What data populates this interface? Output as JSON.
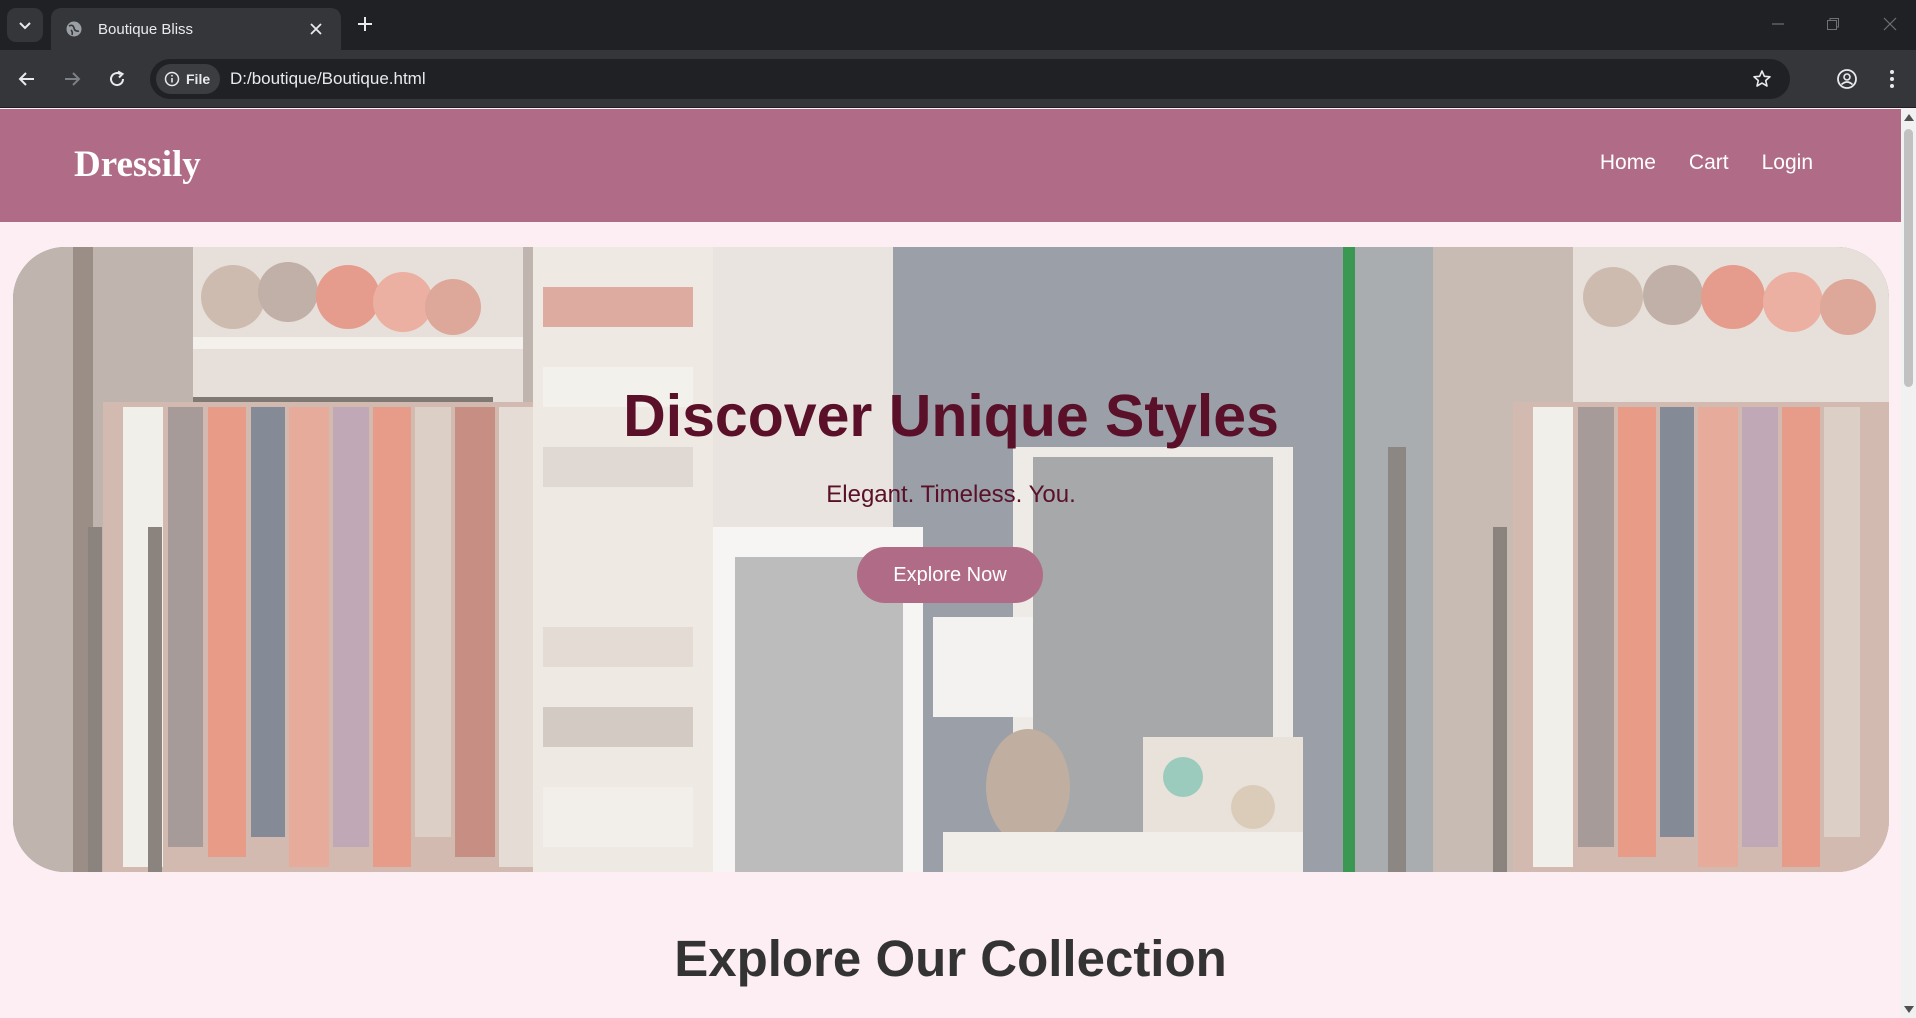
{
  "browser": {
    "tab_title": "Boutique Bliss",
    "url_chip": "File",
    "url": "D:/boutique/Boutique.html"
  },
  "site": {
    "logo": "Dressily",
    "nav": [
      "Home",
      "Cart",
      "Login"
    ],
    "hero": {
      "heading": "Discover Unique Styles",
      "tagline": "Elegant. Timeless. You.",
      "cta": "Explore Now"
    },
    "section_title": "Explore Our Collection"
  },
  "colors": {
    "header_bg": "#b06c86",
    "page_bg": "#fdeef3",
    "hero_text": "#5a1028",
    "button_bg": "#b06c86",
    "section_title": "#333333"
  }
}
